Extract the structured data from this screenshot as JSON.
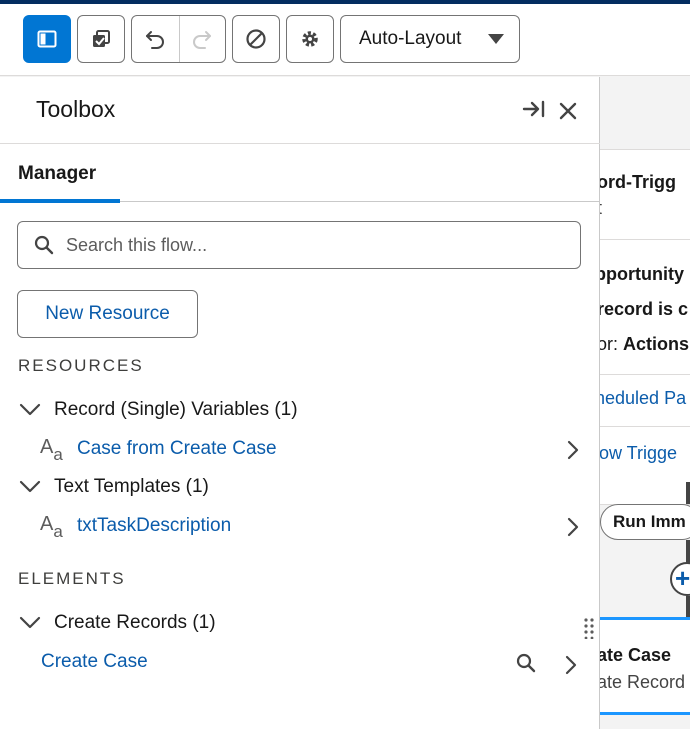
{
  "toolbar": {
    "layout_select": "Auto-Layout",
    "accent": "#0176d3"
  },
  "canvas": {
    "start_title": "ord-Trigg",
    "start_sub": "t",
    "line1": "pportunity",
    "line2": "record is c",
    "line3_prefix": "or: ",
    "line3_bold": "Actions",
    "link1": "heduled Pa",
    "link2": "low Trigge",
    "pill": "Run Imm",
    "element_title": "ate Case",
    "element_sub": "ate Record"
  },
  "panel": {
    "title": "Toolbox",
    "tab": "Manager",
    "search_placeholder": "Search this flow...",
    "new_resource": "New Resource",
    "resources_header": "RESOURCES",
    "resource_groups": [
      {
        "label": "Record (Single) Variables (1)",
        "item": "Case from Create Case",
        "icon": "text-aa-icon"
      },
      {
        "label": "Text Templates (1)",
        "item": "txtTaskDescription",
        "icon": "text-aa-icon"
      }
    ],
    "elements_header": "ELEMENTS",
    "element_groups": [
      {
        "label": "Create Records (1)",
        "item": "Create Case"
      }
    ],
    "aa_glyph": "A",
    "aa_sub": "a"
  }
}
